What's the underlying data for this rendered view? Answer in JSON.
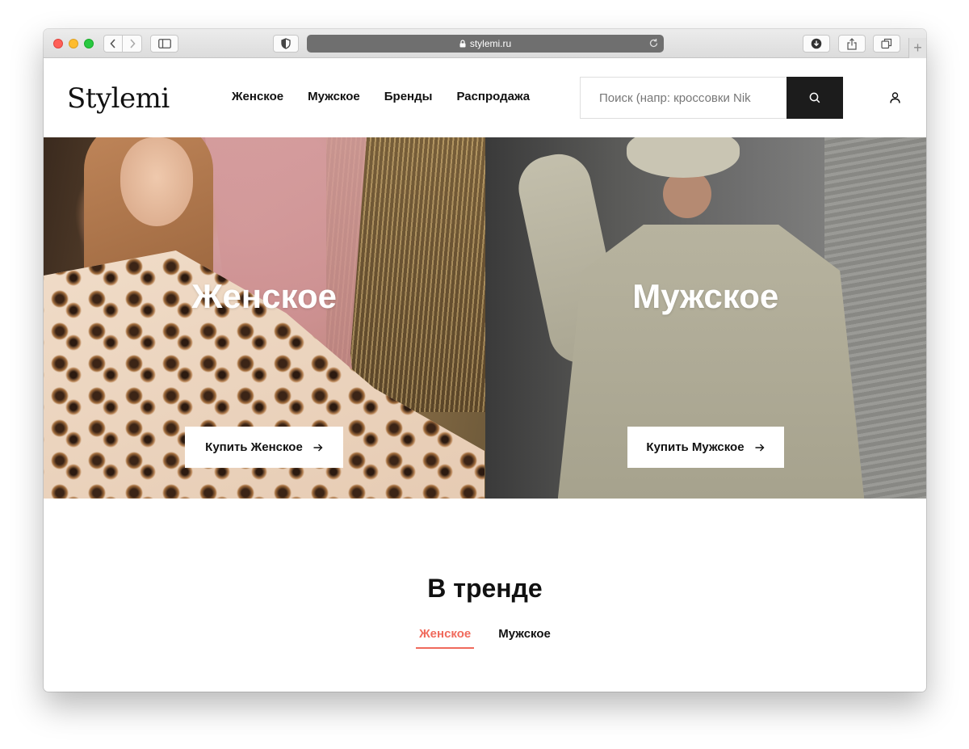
{
  "browser": {
    "url": "stylemi.ru"
  },
  "header": {
    "logo": "Stylemi",
    "nav": [
      {
        "label": "Женское"
      },
      {
        "label": "Мужское"
      },
      {
        "label": "Бренды"
      },
      {
        "label": "Распродажа"
      }
    ],
    "search_placeholder": "Поиск (напр: кроссовки Nik"
  },
  "hero": {
    "women": {
      "title": "Женское",
      "cta": "Купить Женское"
    },
    "men": {
      "title": "Мужское",
      "cta": "Купить Мужское"
    }
  },
  "trending": {
    "title": "В тренде",
    "tabs": [
      {
        "label": "Женское",
        "active": true
      },
      {
        "label": "Мужское",
        "active": false
      }
    ]
  },
  "colors": {
    "accent": "#f06a5c",
    "search_button": "#1c1c1c",
    "text": "#111111"
  },
  "icons": {
    "search": "search-icon",
    "user": "user-icon",
    "arrow": "arrow-right-icon",
    "lock": "lock-icon",
    "reload": "reload-icon"
  }
}
